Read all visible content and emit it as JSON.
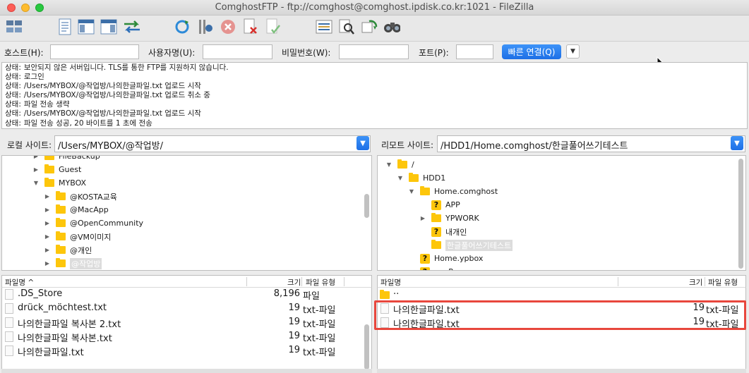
{
  "window": {
    "title": "ComghostFTP - ftp://comghost@comghost.ipdisk.co.kr:1021 - FileZilla"
  },
  "toolbar": {
    "icons": [
      "site-manager-icon",
      "toggle-log-icon",
      "toggle-local-tree-icon",
      "toggle-remote-tree-icon",
      "transfer-queue-icon",
      "refresh-icon",
      "process-queue-icon",
      "cancel-icon",
      "disconnect-icon",
      "reconnect-icon",
      "directory-compare-icon",
      "filter-icon",
      "sync-browse-icon",
      "search-icon"
    ]
  },
  "quickconnect": {
    "host_label": "호스트(H):",
    "host_value": "",
    "user_label": "사용자명(U):",
    "user_value": "",
    "pass_label": "비밀번호(W):",
    "pass_value": "",
    "port_label": "포트(P):",
    "port_value": "",
    "connect_label": "빠른 연결(Q)",
    "dropdown_glyph": "▼"
  },
  "log": {
    "lines": [
      {
        "label": "상태:",
        "text": "보안되지 않은 서버입니다. TLS를 통한 FTP를 지원하지 않습니다."
      },
      {
        "label": "상태:",
        "text": "로그인"
      },
      {
        "label": "상태:",
        "text": "/Users/MYBOX/@작업방/나의한글파일.txt 업로드 시작"
      },
      {
        "label": "상태:",
        "text": "/Users/MYBOX/@작업방/나의한글파일.txt 업로드 취소 중"
      },
      {
        "label": "상태:",
        "text": "파일 전송 생략"
      },
      {
        "label": "상태:",
        "text": "/Users/MYBOX/@작업방/나의한글파일.txt 업로드 시작"
      },
      {
        "label": "상태:",
        "text": "파일 전송 성공, 20 바이트를 1 초에 전송"
      }
    ]
  },
  "local": {
    "site_label": "로컬 사이트:",
    "path": "/Users/MYBOX/@작업방/",
    "tree": [
      {
        "name": "FileBackup",
        "expander": "▶",
        "qmark": false,
        "selected": false
      },
      {
        "name": "Guest",
        "expander": "▶",
        "qmark": false,
        "selected": false
      },
      {
        "name": "MYBOX",
        "expander": "▼",
        "qmark": false,
        "selected": false
      },
      {
        "name": "@KOSTA교육",
        "expander": "▶",
        "qmark": false,
        "selected": false
      },
      {
        "name": "@MacApp",
        "expander": "▶",
        "qmark": false,
        "selected": false
      },
      {
        "name": "@OpenCommunity",
        "expander": "▶",
        "qmark": false,
        "selected": false
      },
      {
        "name": "@VM이미지",
        "expander": "▶",
        "qmark": false,
        "selected": false
      },
      {
        "name": "@개인",
        "expander": "▶",
        "qmark": false,
        "selected": false
      },
      {
        "name": "@작업방",
        "expander": "▶",
        "qmark": false,
        "selected": true
      }
    ],
    "columns": {
      "name": "파일명",
      "sort_glyph": "^",
      "size": "크기",
      "type": "파일 유형"
    },
    "files": [
      {
        "name": ".DS_Store",
        "size": "8,196",
        "type": "파일"
      },
      {
        "name": "drück_möchtest.txt",
        "size": "19",
        "type": "txt-파일"
      },
      {
        "name": "나의한글파일 복사본 2.txt",
        "size": "19",
        "type": "txt-파일"
      },
      {
        "name": "나의한글파일 복사본.txt",
        "size": "19",
        "type": "txt-파일"
      },
      {
        "name": "나의한글파일.txt",
        "size": "19",
        "type": "txt-파일"
      }
    ]
  },
  "remote": {
    "site_label": "리모트 사이트:",
    "path": "/HDD1/Home.comghost/한글풀어쓰기테스트",
    "tree": [
      {
        "name": "/",
        "expander": "▼",
        "qmark": false,
        "selected": false
      },
      {
        "name": "HDD1",
        "expander": "▼",
        "qmark": false,
        "selected": false
      },
      {
        "name": "Home.comghost",
        "expander": "▼",
        "qmark": false,
        "selected": false
      },
      {
        "name": "APP",
        "expander": "",
        "qmark": true,
        "selected": false
      },
      {
        "name": "YPWORK",
        "expander": "▶",
        "qmark": false,
        "selected": false
      },
      {
        "name": "내개인",
        "expander": "",
        "qmark": true,
        "selected": false
      },
      {
        "name": "한글풀어쓰기테스트",
        "expander": "",
        "qmark": false,
        "selected": true
      },
      {
        "name": "Home.ypbox",
        "expander": "",
        "qmark": true,
        "selected": false
      },
      {
        "name": "ovpRepo",
        "expander": "",
        "qmark": true,
        "selected": false
      }
    ],
    "columns": {
      "name": "파일명",
      "size": "크기",
      "type": "파일 유형"
    },
    "parent_label": "..",
    "files": [
      {
        "name": "나의한글파일.txt",
        "size": "19",
        "type": "txt-파일"
      },
      {
        "name": "나의한글파일.txt",
        "size": "19",
        "type": "txt-파일"
      }
    ]
  },
  "colors": {
    "accent": "#1d6fe6",
    "folder": "#fdc60b",
    "highlight": "#e8473d"
  }
}
